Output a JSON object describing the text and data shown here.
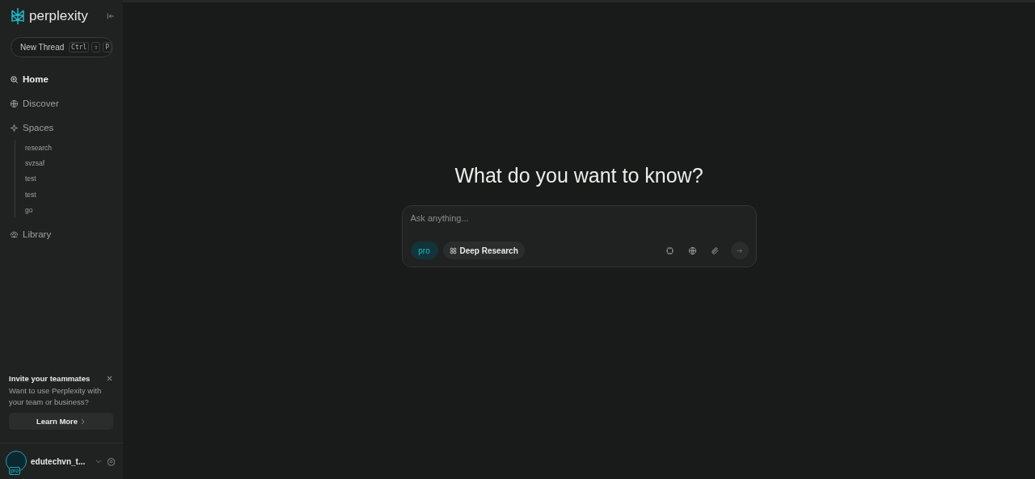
{
  "sidebar": {
    "brand": "perplexity",
    "new_thread": {
      "label": "New Thread",
      "keys": [
        "Ctrl",
        "⇧",
        "P"
      ]
    },
    "nav": [
      {
        "label": "Home",
        "selected": true
      },
      {
        "label": "Discover",
        "selected": false
      },
      {
        "label": "Spaces",
        "selected": false,
        "children": [
          {
            "label": "research"
          },
          {
            "label": "svzsaf"
          },
          {
            "label": "test"
          },
          {
            "label": "test"
          },
          {
            "label": "go"
          }
        ]
      },
      {
        "label": "Library",
        "selected": false
      }
    ],
    "invite": {
      "title": "Invite your teammates",
      "text": "Want to use Perplexity with your team or business?",
      "button": "Learn More"
    },
    "user": {
      "name": "edutechvn_t...",
      "badge": "pro"
    }
  },
  "main": {
    "heading": "What do you want to know?",
    "search": {
      "placeholder": "Ask anything...",
      "pro_toggle": {
        "label": "pro",
        "on": true
      },
      "deep_research": "Deep Research"
    }
  }
}
